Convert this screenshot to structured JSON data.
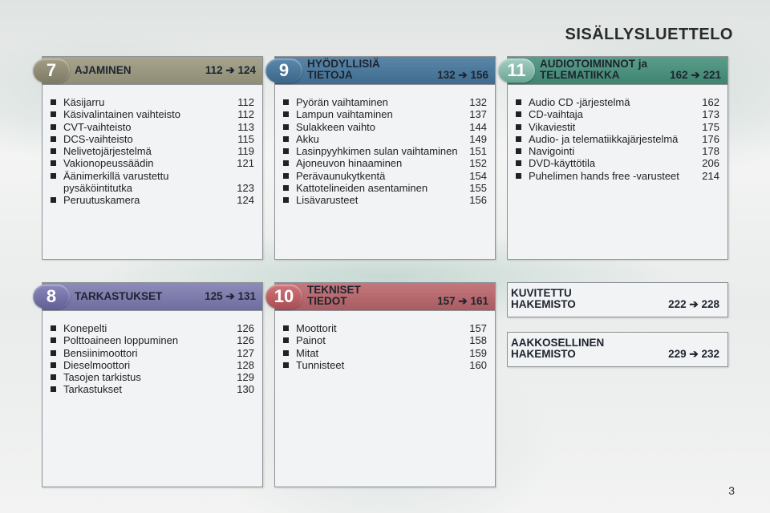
{
  "page": {
    "title": "SISÄLLYSLUETTELO",
    "number": "3"
  },
  "arrow": "➔",
  "sections": {
    "s7": {
      "num": "7",
      "title_line1": "AJAMINEN",
      "range": "112 ➔ 124",
      "items": [
        {
          "text": "Käsijarru",
          "page": "112"
        },
        {
          "text": "Käsivalintainen vaihteisto",
          "page": "112"
        },
        {
          "text": "CVT-vaihteisto",
          "page": "113"
        },
        {
          "text": "DCS-vaihteisto",
          "page": "115"
        },
        {
          "text": "Nelivetojärjestelmä",
          "page": "119"
        },
        {
          "text": "Vakionopeussäädin",
          "page": "121"
        },
        {
          "text": "Äänimerkillä varustettu pysäköintitutka",
          "page": "123"
        },
        {
          "text": "Peruutuskamera",
          "page": "124"
        }
      ]
    },
    "s8": {
      "num": "8",
      "title_line1": "TARKASTUKSET",
      "range": "125 ➔ 131",
      "items": [
        {
          "text": "Konepelti",
          "page": "126"
        },
        {
          "text": "Polttoaineen loppuminen",
          "page": "126"
        },
        {
          "text": "Bensiinimoottori",
          "page": "127"
        },
        {
          "text": "Dieselmoottori",
          "page": "128"
        },
        {
          "text": "Tasojen tarkistus",
          "page": "129"
        },
        {
          "text": "Tarkastukset",
          "page": "130"
        }
      ]
    },
    "s9": {
      "num": "9",
      "title_line1": "HYÖDYLLISIÄ",
      "title_line2": "TIETOJA",
      "range": "132 ➔ 156",
      "items": [
        {
          "text": "Pyörän vaihtaminen",
          "page": "132"
        },
        {
          "text": "Lampun vaihtaminen",
          "page": "137"
        },
        {
          "text": "Sulakkeen vaihto",
          "page": "144"
        },
        {
          "text": "Akku",
          "page": "149"
        },
        {
          "text": "Lasinpyyhkimen sulan vaihtaminen",
          "page": "151"
        },
        {
          "text": "Ajoneuvon hinaaminen",
          "page": "152"
        },
        {
          "text": "Perävaunukytkentä",
          "page": "154"
        },
        {
          "text": "Kattotelineiden asentaminen",
          "page": "155"
        },
        {
          "text": "Lisävarusteet",
          "page": "156"
        }
      ]
    },
    "s10": {
      "num": "10",
      "title_line1": "TEKNISET",
      "title_line2": "TIEDOT",
      "range": "157 ➔ 161",
      "items": [
        {
          "text": "Moottorit",
          "page": "157"
        },
        {
          "text": "Painot",
          "page": "158"
        },
        {
          "text": "Mitat",
          "page": "159"
        },
        {
          "text": "Tunnisteet",
          "page": "160"
        }
      ]
    },
    "s11": {
      "num": "11",
      "title_line1": "AUDIOTOIMINNOT ja",
      "title_line2": "TELEMATIIKKA",
      "range": "162 ➔ 221",
      "items": [
        {
          "text": "Audio CD -järjestelmä",
          "page": "162"
        },
        {
          "text": "CD-vaihtaja",
          "page": "173"
        },
        {
          "text": "Vikaviestit",
          "page": "175"
        },
        {
          "text": "Audio- ja telematiikkajärjestelmä",
          "page": "176"
        },
        {
          "text": "Navigointi",
          "page": "178"
        },
        {
          "text": "DVD-käyttötila",
          "page": "206"
        },
        {
          "text": "Puhelimen hands free -varusteet",
          "page": "214"
        }
      ]
    }
  },
  "indexes": {
    "pictorial": {
      "line1": "KUVITETTU",
      "line2": "HAKEMISTO",
      "range": "222 ➔ 228"
    },
    "alphabetical": {
      "line1": "AAKKOSELLINEN",
      "line2": "HAKEMISTO",
      "range": "229 ➔ 232"
    }
  }
}
